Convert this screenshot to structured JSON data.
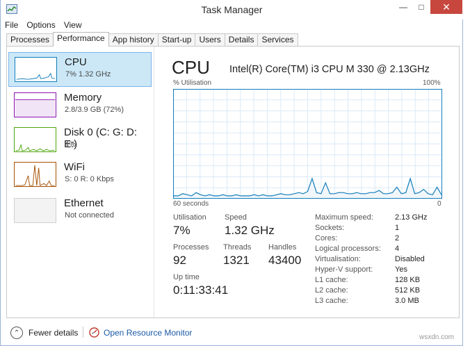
{
  "window": {
    "title": "Task Manager",
    "controls": {
      "minimize": "—",
      "maximize": "□",
      "close": "✕"
    }
  },
  "menu": [
    "File",
    "Options",
    "View"
  ],
  "tabs": [
    "Processes",
    "Performance",
    "App history",
    "Start-up",
    "Users",
    "Details",
    "Services"
  ],
  "active_tab": "Performance",
  "sidebar": [
    {
      "name": "CPU",
      "sub": "7% 1.32 GHz",
      "color": "#117dbb",
      "selected": true
    },
    {
      "name": "Memory",
      "sub": "2.8/3.9 GB (72%)",
      "color": "#8b12ae",
      "selected": false
    },
    {
      "name": "Disk 0 (C: G: D: E:)",
      "sub": "4%",
      "color": "#4da60c",
      "selected": false
    },
    {
      "name": "WiFi",
      "sub": "S: 0 R: 0 Kbps",
      "color": "#a74f01",
      "selected": false
    },
    {
      "name": "Ethernet",
      "sub": "Not connected",
      "color": "#999999",
      "selected": false
    }
  ],
  "detail": {
    "title": "CPU",
    "model": "Intel(R) Core(TM) i3 CPU M 330 @ 2.13GHz",
    "graph": {
      "y_label": "% Utilisation",
      "y_max_label": "100%",
      "x_left_label": "60 seconds",
      "x_right_label": "0",
      "line_color": "#117dbb",
      "values": [
        2,
        2,
        4,
        3,
        2,
        5,
        3,
        2,
        3,
        2,
        2,
        3,
        2,
        2,
        3,
        2,
        2,
        2,
        3,
        2,
        3,
        2,
        2,
        3,
        4,
        3,
        3,
        4,
        5,
        4,
        6,
        18,
        5,
        4,
        14,
        4,
        4,
        5,
        5,
        4,
        4,
        5,
        4,
        4,
        5,
        5,
        7,
        4,
        4,
        5,
        10,
        4,
        5,
        18,
        4,
        5,
        8,
        4,
        3,
        10,
        3
      ]
    },
    "stats": {
      "utilisation_label": "Utilisation",
      "utilisation": "7%",
      "speed_label": "Speed",
      "speed": "1.32 GHz",
      "processes_label": "Processes",
      "processes": "92",
      "threads_label": "Threads",
      "threads": "1321",
      "handles_label": "Handles",
      "handles": "43400",
      "uptime_label": "Up time",
      "uptime": "0:11:33:41"
    },
    "specs": [
      {
        "label": "Maximum speed:",
        "value": "2.13 GHz"
      },
      {
        "label": "Sockets:",
        "value": "1"
      },
      {
        "label": "Cores:",
        "value": "2"
      },
      {
        "label": "Logical processors:",
        "value": "4"
      },
      {
        "label": "Virtualisation:",
        "value": "Disabled"
      },
      {
        "label": "Hyper-V support:",
        "value": "Yes"
      },
      {
        "label": "L1 cache:",
        "value": "128 KB"
      },
      {
        "label": "L2 cache:",
        "value": "512 KB"
      },
      {
        "label": "L3 cache:",
        "value": "3.0 MB"
      }
    ]
  },
  "footer": {
    "fewer_details": "Fewer details",
    "resource_monitor": "Open Resource Monitor",
    "watermark": "wsxdn.com"
  }
}
